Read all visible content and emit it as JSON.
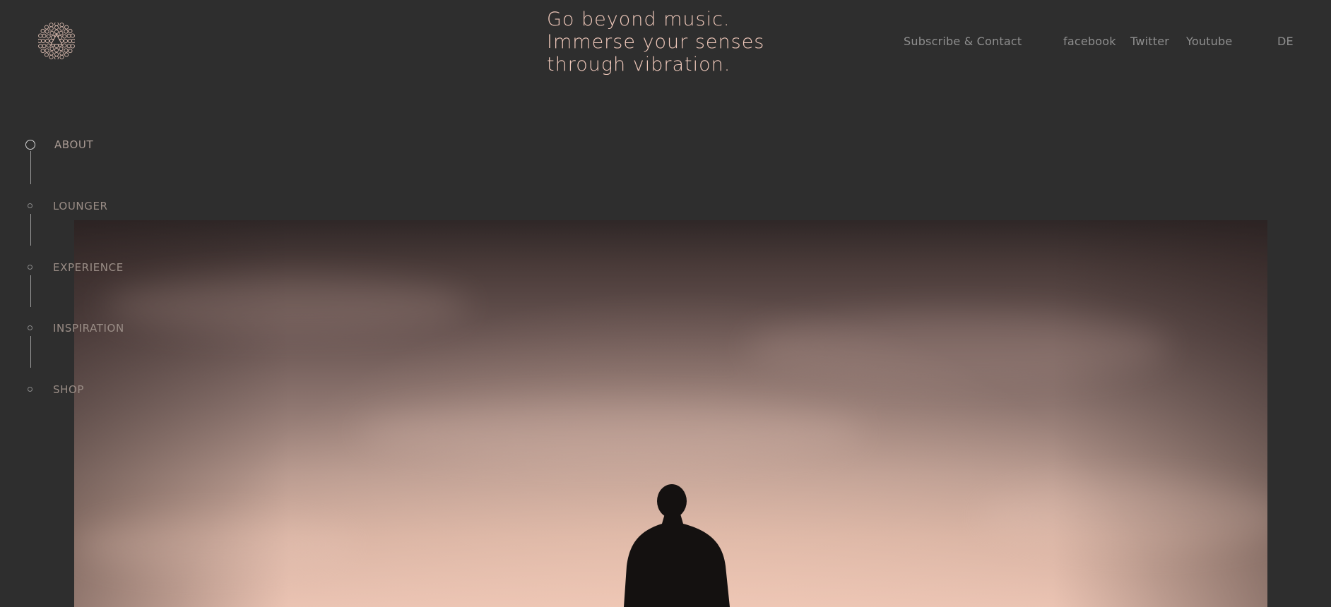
{
  "logo": {
    "name": "logo-icon",
    "color": "#d8b9ad"
  },
  "tagline": {
    "lines": [
      "Go beyond music.",
      "Immerse your senses",
      "through vibration."
    ],
    "color": "#f0c9bb"
  },
  "topnav": {
    "subscribe": "Subscribe & Contact",
    "facebook": "facebook",
    "twitter": "Twitter",
    "youtube": "Youtube",
    "language": "DE"
  },
  "sidenav": {
    "items": [
      {
        "label": "ABOUT",
        "active": true
      },
      {
        "label": "LOUNGER",
        "active": false
      },
      {
        "label": "EXPERIENCE",
        "active": false
      },
      {
        "label": "INSPIRATION",
        "active": false
      },
      {
        "label": "SHOP",
        "active": false
      }
    ]
  },
  "hero": {
    "subject": "person-silhouette",
    "sky_colors": [
      "#2f2727",
      "#8e7670",
      "#e9c2b2"
    ]
  },
  "colors": {
    "background": "#2e2e2e",
    "nav_text": "#8f8f8f",
    "accent": "#f0c9bb"
  }
}
